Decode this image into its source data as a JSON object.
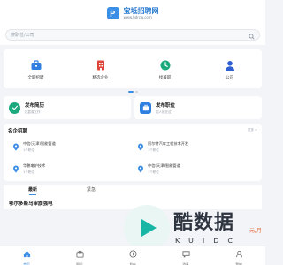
{
  "header": {
    "logo_name": "宝坻招聘网",
    "logo_url": "www.bdrcw.com"
  },
  "search": {
    "placeholder": "搜职位/公司"
  },
  "quick_menu": [
    {
      "label": "全职招聘",
      "icon": "briefcase-icon",
      "color": "#2f7fe0"
    },
    {
      "label": "精选企业",
      "icon": "building-icon",
      "color": "#e0453a"
    },
    {
      "label": "找兼职",
      "icon": "clock-icon",
      "color": "#1aa87c"
    },
    {
      "label": "公司",
      "icon": "user-icon",
      "color": "#2f5fd0"
    }
  ],
  "publish": {
    "resume": {
      "title": "发布简历",
      "subtitle": "找靠谱工作"
    },
    "job": {
      "title": "发布职位",
      "subtitle": "招人就在这"
    }
  },
  "enterprises": {
    "title": "名企招聘",
    "more": "更多 >",
    "items": [
      {
        "name": "中信(天津)智能管道",
        "count": "1个职位"
      },
      {
        "name": "阿尔特汽车工程技术开发",
        "count": "1个职位"
      },
      {
        "name": "华鹏电炉技术",
        "count": "1个职位"
      },
      {
        "name": "中信(天津)智能管道",
        "count": "1个职位"
      }
    ]
  },
  "tabs": {
    "latest": "最新",
    "urgent": "紧急"
  },
  "job_listing": {
    "first_title": "鄂尔多斯乌审旗强电"
  },
  "bottom_nav": [
    {
      "label": "首页"
    },
    {
      "label": "职位"
    },
    {
      "label": "发布"
    },
    {
      "label": "消息"
    },
    {
      "label": "我的"
    }
  ],
  "watermark": {
    "main": "酷数据",
    "sub": "KUIDC",
    "tail": "元/月"
  },
  "colors": {
    "accent": "#3a8ee6",
    "watermark_play": "#17b5a3"
  }
}
